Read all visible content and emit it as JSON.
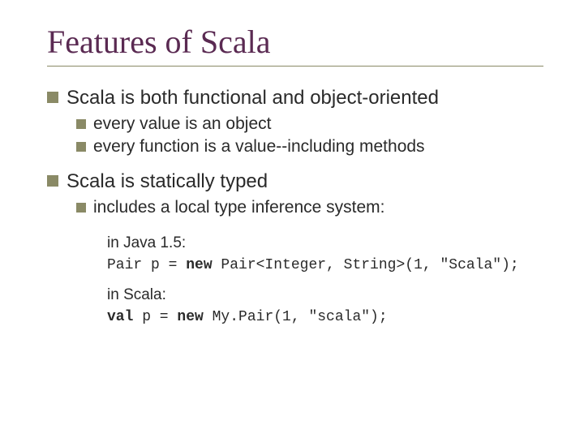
{
  "title": "Features of Scala",
  "bullets": {
    "b1": "Scala is both functional and object-oriented",
    "b1a": "every value is an object",
    "b1b": "every function is a value--including methods",
    "b2": "Scala is statically typed",
    "b2a": "includes a local type inference system:"
  },
  "labels": {
    "java": "in Java 1.5:",
    "scala": "in Scala:"
  },
  "code": {
    "java_pre": "Pair p = ",
    "java_kw": "new",
    "java_post": " Pair<Integer, String>(1, \"Scala\");",
    "scala_kw1": "val",
    "scala_mid": " p = ",
    "scala_kw2": "new",
    "scala_post": " My.Pair(1, \"scala\");"
  }
}
